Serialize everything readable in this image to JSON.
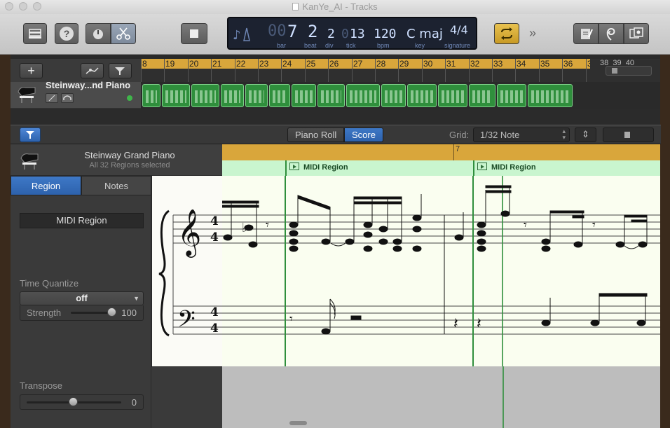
{
  "window": {
    "title": "KanYe_AI - Tracks",
    "colors": {
      "accent_blue": "#2d62ad",
      "region_green": "#2f8f3c",
      "ruler_gold": "#d9a63b",
      "lcd_bg": "#1c2230"
    }
  },
  "toolbar": {
    "icons": [
      "library-icon",
      "help-icon",
      "smart-controls-icon",
      "editors-scissors-icon",
      "stop-icon",
      "cycle-icon",
      "more-icon",
      "notepad-icon",
      "loops-icon",
      "media-browser-icon"
    ],
    "lcd": {
      "bar": "7",
      "bar_lead": "00",
      "beat": "2",
      "div": "2",
      "tick_lead": "0",
      "tick": "13",
      "bpm": "120",
      "key": "C maj",
      "signature": "4/4",
      "labels": {
        "bar": "bar",
        "beat": "beat",
        "div": "div",
        "tick": "tick",
        "bpm": "bpm",
        "key": "key",
        "signature": "signature"
      }
    }
  },
  "tracks": {
    "track_name": "Steinway...nd Piano",
    "ruler_numbers": [
      "8",
      "19",
      "20",
      "21",
      "22",
      "23",
      "24",
      "25",
      "26",
      "27",
      "28",
      "29",
      "30",
      "31",
      "32",
      "33",
      "34",
      "35",
      "36",
      "37",
      "38",
      "39",
      "40"
    ]
  },
  "editor": {
    "tabs": {
      "piano_roll": "Piano Roll",
      "score": "Score"
    },
    "grid_label": "Grid:",
    "grid_value": "1/32 Note",
    "instrument_name": "Steinway Grand Piano",
    "selection_status": "All 32 Regions selected",
    "measure_number": "7",
    "region_labels": [
      "MIDI Region",
      "MIDI Region"
    ],
    "time_signature": {
      "top": "4",
      "bottom": "4"
    }
  },
  "inspector": {
    "tabs": {
      "region": "Region",
      "notes": "Notes"
    },
    "region_name": "MIDI Region",
    "time_quantize_label": "Time Quantize",
    "time_quantize_value": "off",
    "strength_label": "Strength",
    "strength_value": "100",
    "transpose_label": "Transpose",
    "transpose_value": "0"
  }
}
